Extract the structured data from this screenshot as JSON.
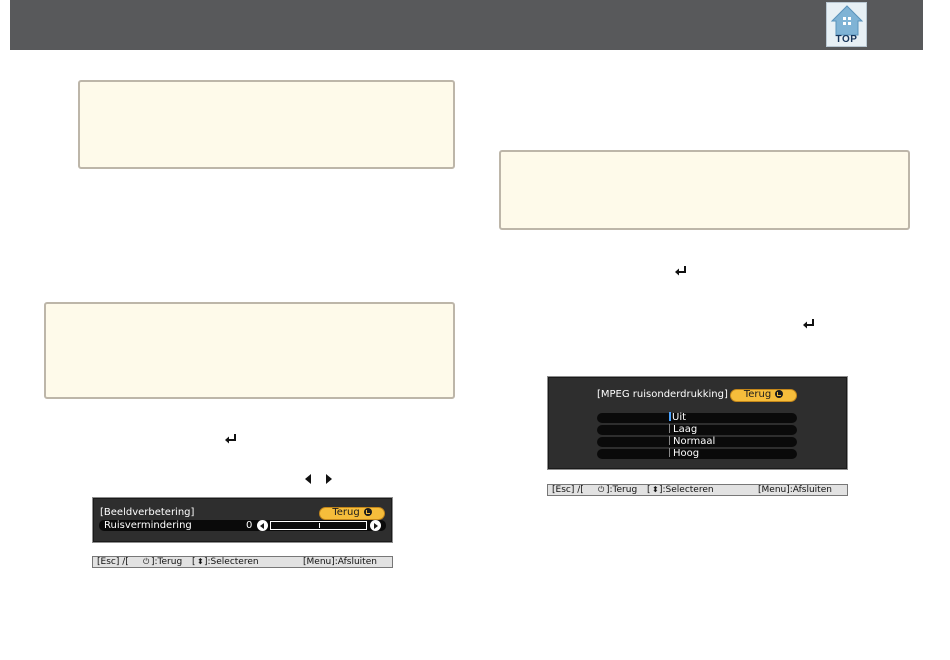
{
  "header": {
    "top_button_label": "TOP",
    "colors": {
      "bar": "#58595b",
      "button_bg": "#e7f0f5",
      "house": "#7fb3d5"
    }
  },
  "note_color": "#fefaea",
  "osd_left": {
    "title": "[Beeldverbetering]",
    "back_label": "Terug",
    "row_label": "Ruisvermindering",
    "row_value": "0",
    "slider_level": 0.0
  },
  "help_left": {
    "esc": "[Esc] /[",
    "back": "]:Terug",
    "select_bracket": "[",
    "select": "]:Selecteren",
    "menu": "[Menu]:Afsluiten"
  },
  "osd_right": {
    "title": "[MPEG ruisonderdrukking]",
    "back_label": "Terug",
    "options": [
      "Uit",
      "Laag",
      "Normaal",
      "Hoog"
    ]
  },
  "help_right": {
    "esc": "[Esc] /[",
    "back": "]:Terug",
    "select_bracket": "[",
    "select": "]:Selecteren",
    "menu": "[Menu]:Afsluiten"
  },
  "icons": [
    "top-home-icon",
    "enter-icon",
    "left-arrow-icon",
    "right-arrow-icon",
    "power-icon",
    "updown-icon"
  ],
  "osd_colors": {
    "panel": "#2e2e2e",
    "button": "#f6bd3b",
    "cursor": "#4aa3ff"
  }
}
